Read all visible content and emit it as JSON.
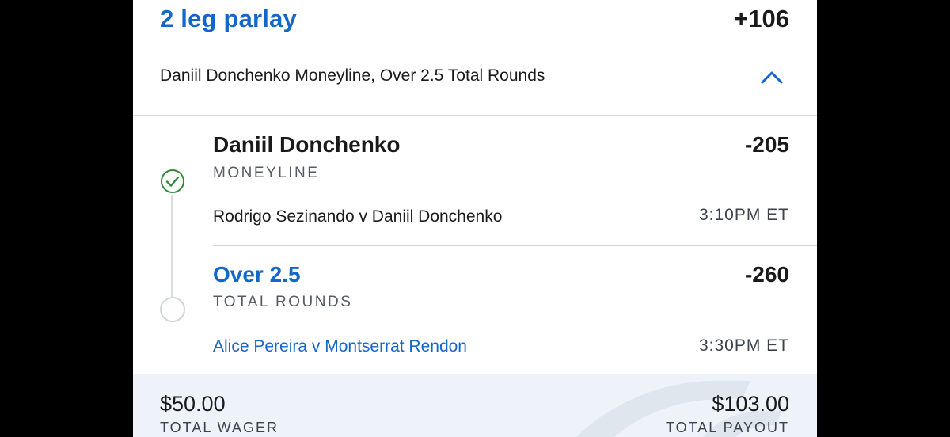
{
  "parlay": {
    "title": "2 leg parlay",
    "odds": "+106",
    "description": "Daniil Donchenko Moneyline, Over 2.5 Total Rounds",
    "expanded_icon": "chevron-up-icon"
  },
  "legs": [
    {
      "selection": "Daniil Donchenko",
      "odds": "-205",
      "market": "MONEYLINE",
      "event": "Rodrigo Sezinando v Daniil Donchenko",
      "time": "3:10PM ET",
      "status_icon": "check-circle-icon"
    },
    {
      "selection": "Over 2.5",
      "odds": "-260",
      "market": "TOTAL ROUNDS",
      "event": "Alice Pereira v Montserrat Rendon",
      "time": "3:30PM ET",
      "status_icon": "empty-circle-icon"
    }
  ],
  "footer": {
    "wager_amount": "$50.00",
    "wager_label": "TOTAL WAGER",
    "payout_amount": "$103.00",
    "payout_label": "TOTAL PAYOUT"
  },
  "colors": {
    "accent": "#1467c8",
    "win_green": "#2e8b3c",
    "footer_bg": "#eef3f9"
  }
}
